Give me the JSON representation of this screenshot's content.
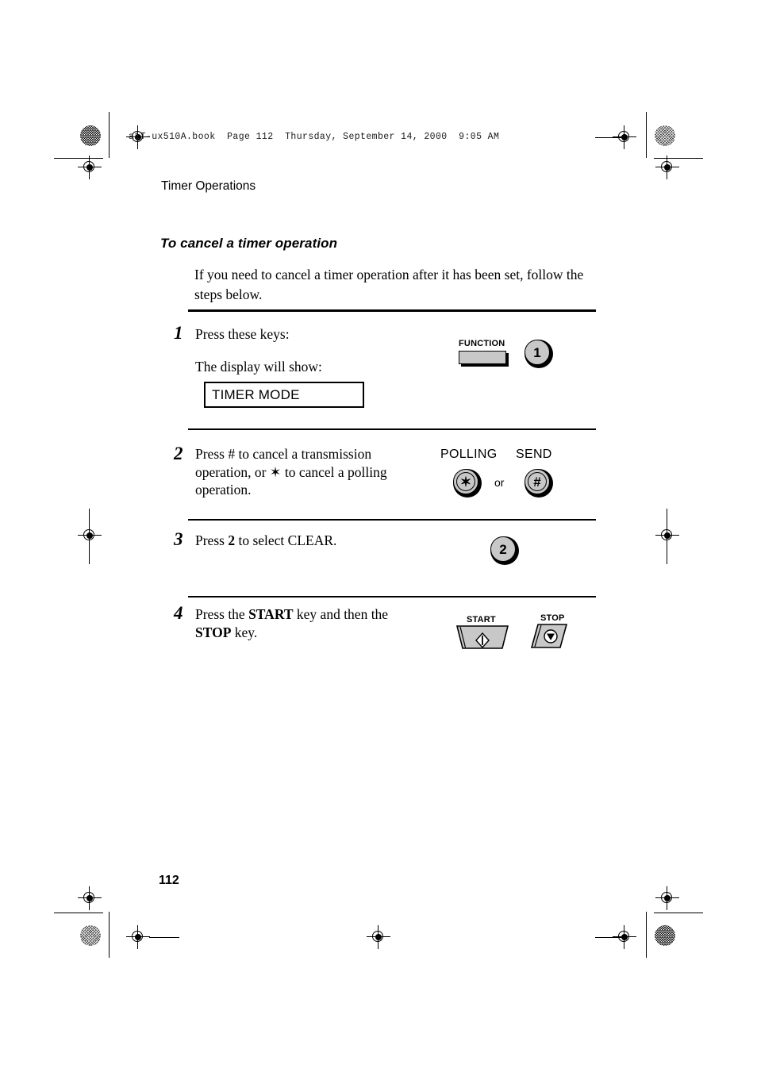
{
  "job_header": "a1T-ux510A.book  Page 112  Thursday, September 14, 2000  9:05 AM",
  "running_head": "Timer Operations",
  "section_heading": "To cancel a timer operation",
  "intro": "If you need to cancel a timer operation after it has been set, follow the steps below.",
  "folio": "112",
  "steps": [
    {
      "number": "1",
      "line1": "Press these keys:",
      "line2": "The display will show:",
      "display_text": "TIMER MODE",
      "keys": {
        "function_label": "FUNCTION",
        "one_label": "1"
      }
    },
    {
      "number": "2",
      "text_a": "Press # to cancel a transmission operation, or ",
      "text_sym": "✶",
      "text_b": " to cancel a polling operation.",
      "keys": {
        "polling_label": "POLLING",
        "send_label": "SEND",
        "star_glyph": "✶",
        "hash_glyph": "#",
        "or_label": "or"
      }
    },
    {
      "number": "3",
      "text_a": "Press ",
      "text_bold": "2",
      "text_b": " to select CLEAR.",
      "keys": {
        "two_label": "2"
      }
    },
    {
      "number": "4",
      "text_a": "Press the ",
      "text_bold1": "START",
      "text_mid": " key and then the ",
      "text_bold2": "STOP",
      "text_b": " key.",
      "keys": {
        "start_label": "START",
        "stop_label": "STOP"
      }
    }
  ],
  "colors": {
    "key_face": "#c8c8c8",
    "ink": "#000000",
    "paper": "#ffffff"
  }
}
